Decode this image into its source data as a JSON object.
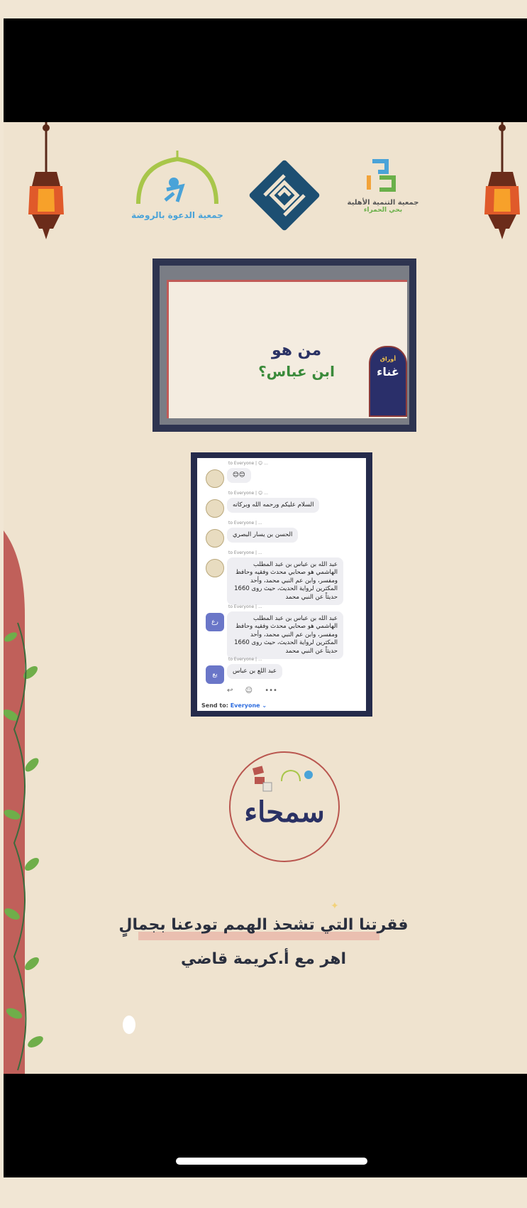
{
  "logos": {
    "left_org": "جمعية الدعوة بالروضة",
    "right_org": "جمعية التنمية الأهلية",
    "right_org_sub": "بحي الحمراء"
  },
  "slide": {
    "question_line1": "من هو",
    "question_line2": "ابن عباس؟",
    "badge_top": "أوراق",
    "badge_main": "غناء"
  },
  "chat": {
    "messages": [
      {
        "meta": "to Everyone | 😊 ...",
        "text": "😊😊",
        "avatar": "logo"
      },
      {
        "meta": "to Everyone | 😊 ...",
        "text": "السلام عليكم ورحمه الله وبركاته",
        "avatar": "logo"
      },
      {
        "meta": "to Everyone | ...",
        "text": "الحسن بن يسار البصري",
        "avatar": "logo"
      },
      {
        "meta": "to Everyone | ...",
        "text": "عبد الله بن عباس بن عبد المطلب الهاشمي هو صحابي محدث وفقيه وحافظ ومفسر، وابن عم النبي محمد، وأحد المكثرين لرواية الحديث، حيث روى 1660 حديثاً عن النبي محمد",
        "avatar": "logo"
      },
      {
        "meta": "to Everyone | ...",
        "text": "عبد الله بن عباس بن عبد المطلب الهاشمي هو صحابي محدث وفقيه وحافظ ومفسر، وابن عم النبي محمد، وأحد المكثرين لرواية الحديث، حيث روى 1660 حديثاً عن النبي محمد",
        "avatar": "blue",
        "avatar_text": "رع"
      },
      {
        "meta": "to Everyone | ...",
        "text": "عبد اللع بن عباس",
        "avatar": "blue",
        "avatar_text": "يع"
      }
    ],
    "send_to_label": "Send to:",
    "send_to_value": "Everyone"
  },
  "circle_logo": {
    "title": "سمحاء"
  },
  "subtitle": {
    "line1": "فقرتنا التي تشحذ الهمم تودعنا بجمالٍ",
    "line2": "اهر مع أ.كريمة قاضي"
  },
  "colors": {
    "background": "#efe3cf",
    "navy": "#252b4b",
    "accent_red": "#b9564f",
    "green": "#3a8a3a"
  }
}
